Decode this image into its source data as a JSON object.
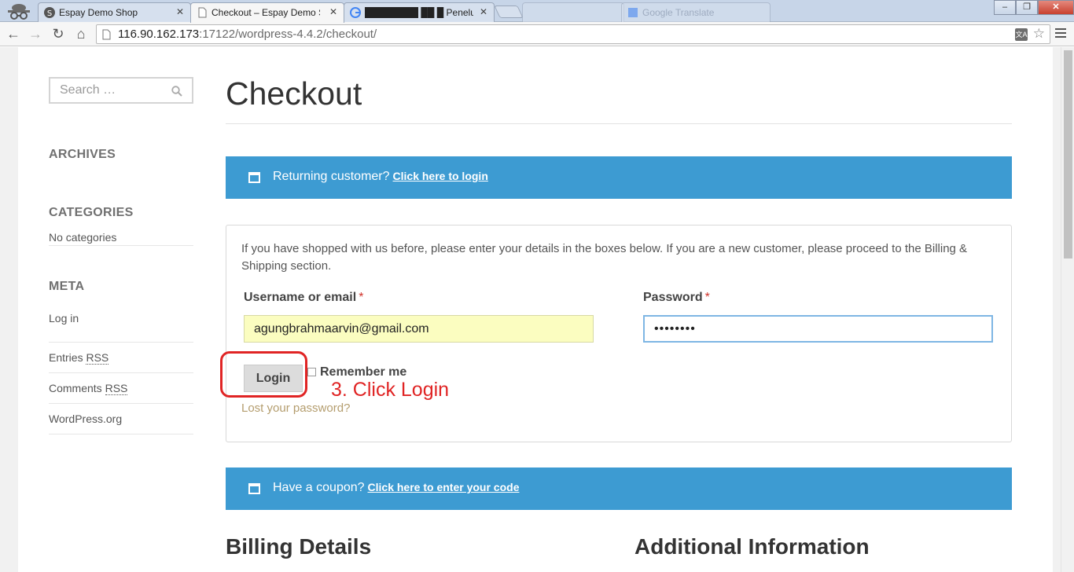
{
  "browser": {
    "tabs": [
      {
        "label": "Espay Demo Shop",
        "active": false
      },
      {
        "label": "Checkout – Espay Demo S",
        "active": true
      },
      {
        "label": "████████ ██ █ Penelu",
        "active": false
      },
      {
        "label": "",
        "active": false
      },
      {
        "label": "Google Translate",
        "active": false
      }
    ],
    "address": {
      "host": "116.90.162.173",
      "rest": ":17122/wordpress-4.4.2/checkout/"
    },
    "window_buttons": {
      "minimize": "–",
      "maximize": "❐",
      "close": "✕"
    }
  },
  "sidebar": {
    "search_placeholder": "Search …",
    "archives_title": "ARCHIVES",
    "categories_title": "CATEGORIES",
    "categories_empty": "No categories",
    "meta_title": "META",
    "meta_links": {
      "login": "Log in",
      "entries": "Entries",
      "comments": "Comments",
      "rss": "RSS",
      "wordpress": "WordPress.org"
    }
  },
  "main": {
    "title": "Checkout",
    "returning_notice": {
      "text": "Returning customer?",
      "link": "Click here to login"
    },
    "intro": "If you have shopped with us before, please enter your details in the boxes below. If you are a new customer, please proceed to the Billing & Shipping section.",
    "username_label": "Username or email",
    "password_label": "Password",
    "required_mark": "*",
    "username_value": "agungbrahmaarvin@gmail.com",
    "password_value": "••••••••",
    "login_button": "Login",
    "remember_me": "Remember me",
    "lost_password": "Lost your password?",
    "coupon_notice": {
      "text": "Have a coupon?",
      "link": "Click here to enter your code"
    },
    "billing_title": "Billing Details",
    "additional_title": "Additional Information"
  },
  "annotation": {
    "text": "3. Click Login",
    "color": "#e02424"
  },
  "colors": {
    "notice_bg": "#3d9bd2",
    "autofill_bg": "#fbfdc0",
    "link_gold": "#b49d6e"
  }
}
